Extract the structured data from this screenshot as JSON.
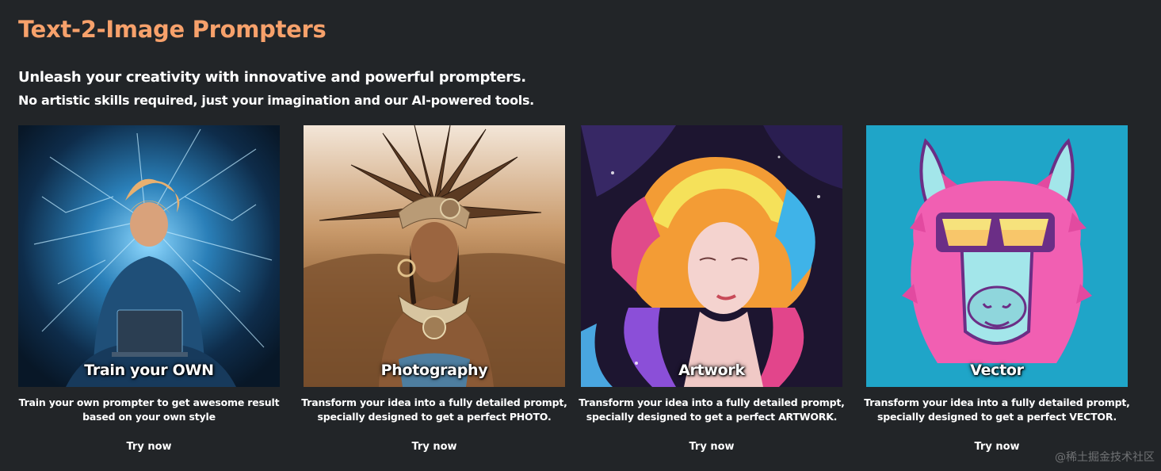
{
  "header": {
    "title": "Text-2-Image Prompters",
    "subtitle_1": "Unleash your creativity with innovative and powerful prompters.",
    "subtitle_2": "No artistic skills required, just your imagination and our AI-powered tools."
  },
  "colors": {
    "background": "#222528",
    "title_accent": "#f7a16b",
    "text": "#ffffff"
  },
  "cards": [
    {
      "label": "Train your OWN",
      "image": "hacker-with-laptop-image",
      "desc_line_1": "Train your own prompter to get awesome result",
      "desc_line_2": "based on your own style",
      "cta": "Try now"
    },
    {
      "label": "Photography",
      "image": "tribal-woman-headdress-image",
      "desc_line_1": "Transform your idea into a fully detailed prompt,",
      "desc_line_2": "specially designed to get a perfect PHOTO.",
      "cta": "Try now"
    },
    {
      "label": "Artwork",
      "image": "colorful-hair-woman-painting-image",
      "desc_line_1": "Transform your idea into a fully detailed prompt,",
      "desc_line_2": "specially designed to get a perfect ARTWORK.",
      "cta": "Try now"
    },
    {
      "label": "Vector",
      "image": "llama-with-sunglasses-vector-image",
      "desc_line_1": "Transform your idea into a fully detailed prompt,",
      "desc_line_2": "specially designed to get a perfect VECTOR.",
      "cta": "Try now"
    }
  ],
  "watermark": "@稀土掘金技术社区"
}
